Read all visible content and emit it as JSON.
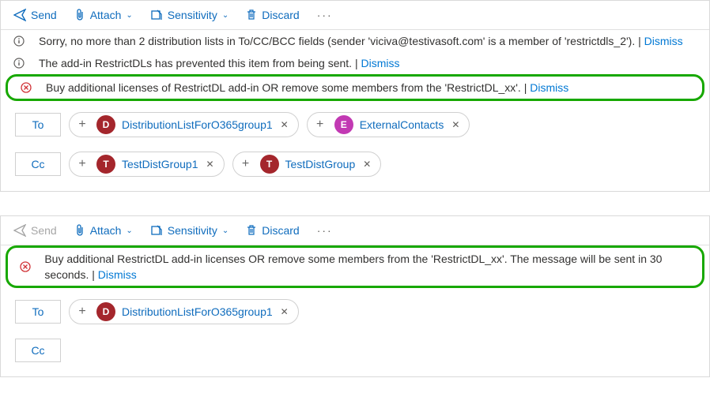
{
  "toolbar": {
    "send": "Send",
    "attach": "Attach",
    "sensitivity": "Sensitivity",
    "discard": "Discard"
  },
  "panel1": {
    "info1": "Sorry, no more than 2 distribution lists in To/CC/BCC fields (sender 'viciva@testivasoft.com' is a member of 'restrictdls_2'). | ",
    "info2": "The add-in RestrictDLs has prevented this item from being sent. | ",
    "err1": "Buy additional licenses of RestrictDL add-in OR remove some members from the 'RestrictDL_xx'. | ",
    "dismiss": "Dismiss",
    "to_label": "To",
    "cc_label": "Cc",
    "chips_to": [
      {
        "initial": "D",
        "name": "DistributionListForO365group1",
        "avclass": "av-d"
      },
      {
        "initial": "E",
        "name": "ExternalContacts",
        "avclass": "av-e"
      }
    ],
    "chips_cc": [
      {
        "initial": "T",
        "name": "TestDistGroup1",
        "avclass": "av-t"
      },
      {
        "initial": "T",
        "name": "TestDistGroup",
        "avclass": "av-t"
      }
    ]
  },
  "panel2": {
    "err1": "Buy additional RestrictDL add-in licenses OR remove some members from the 'RestrictDL_xx'. The message will be sent in 30 seconds. | ",
    "dismiss": "Dismiss",
    "to_label": "To",
    "cc_label": "Cc",
    "chips_to": [
      {
        "initial": "D",
        "name": "DistributionListForO365group1",
        "avclass": "av-d"
      }
    ]
  }
}
